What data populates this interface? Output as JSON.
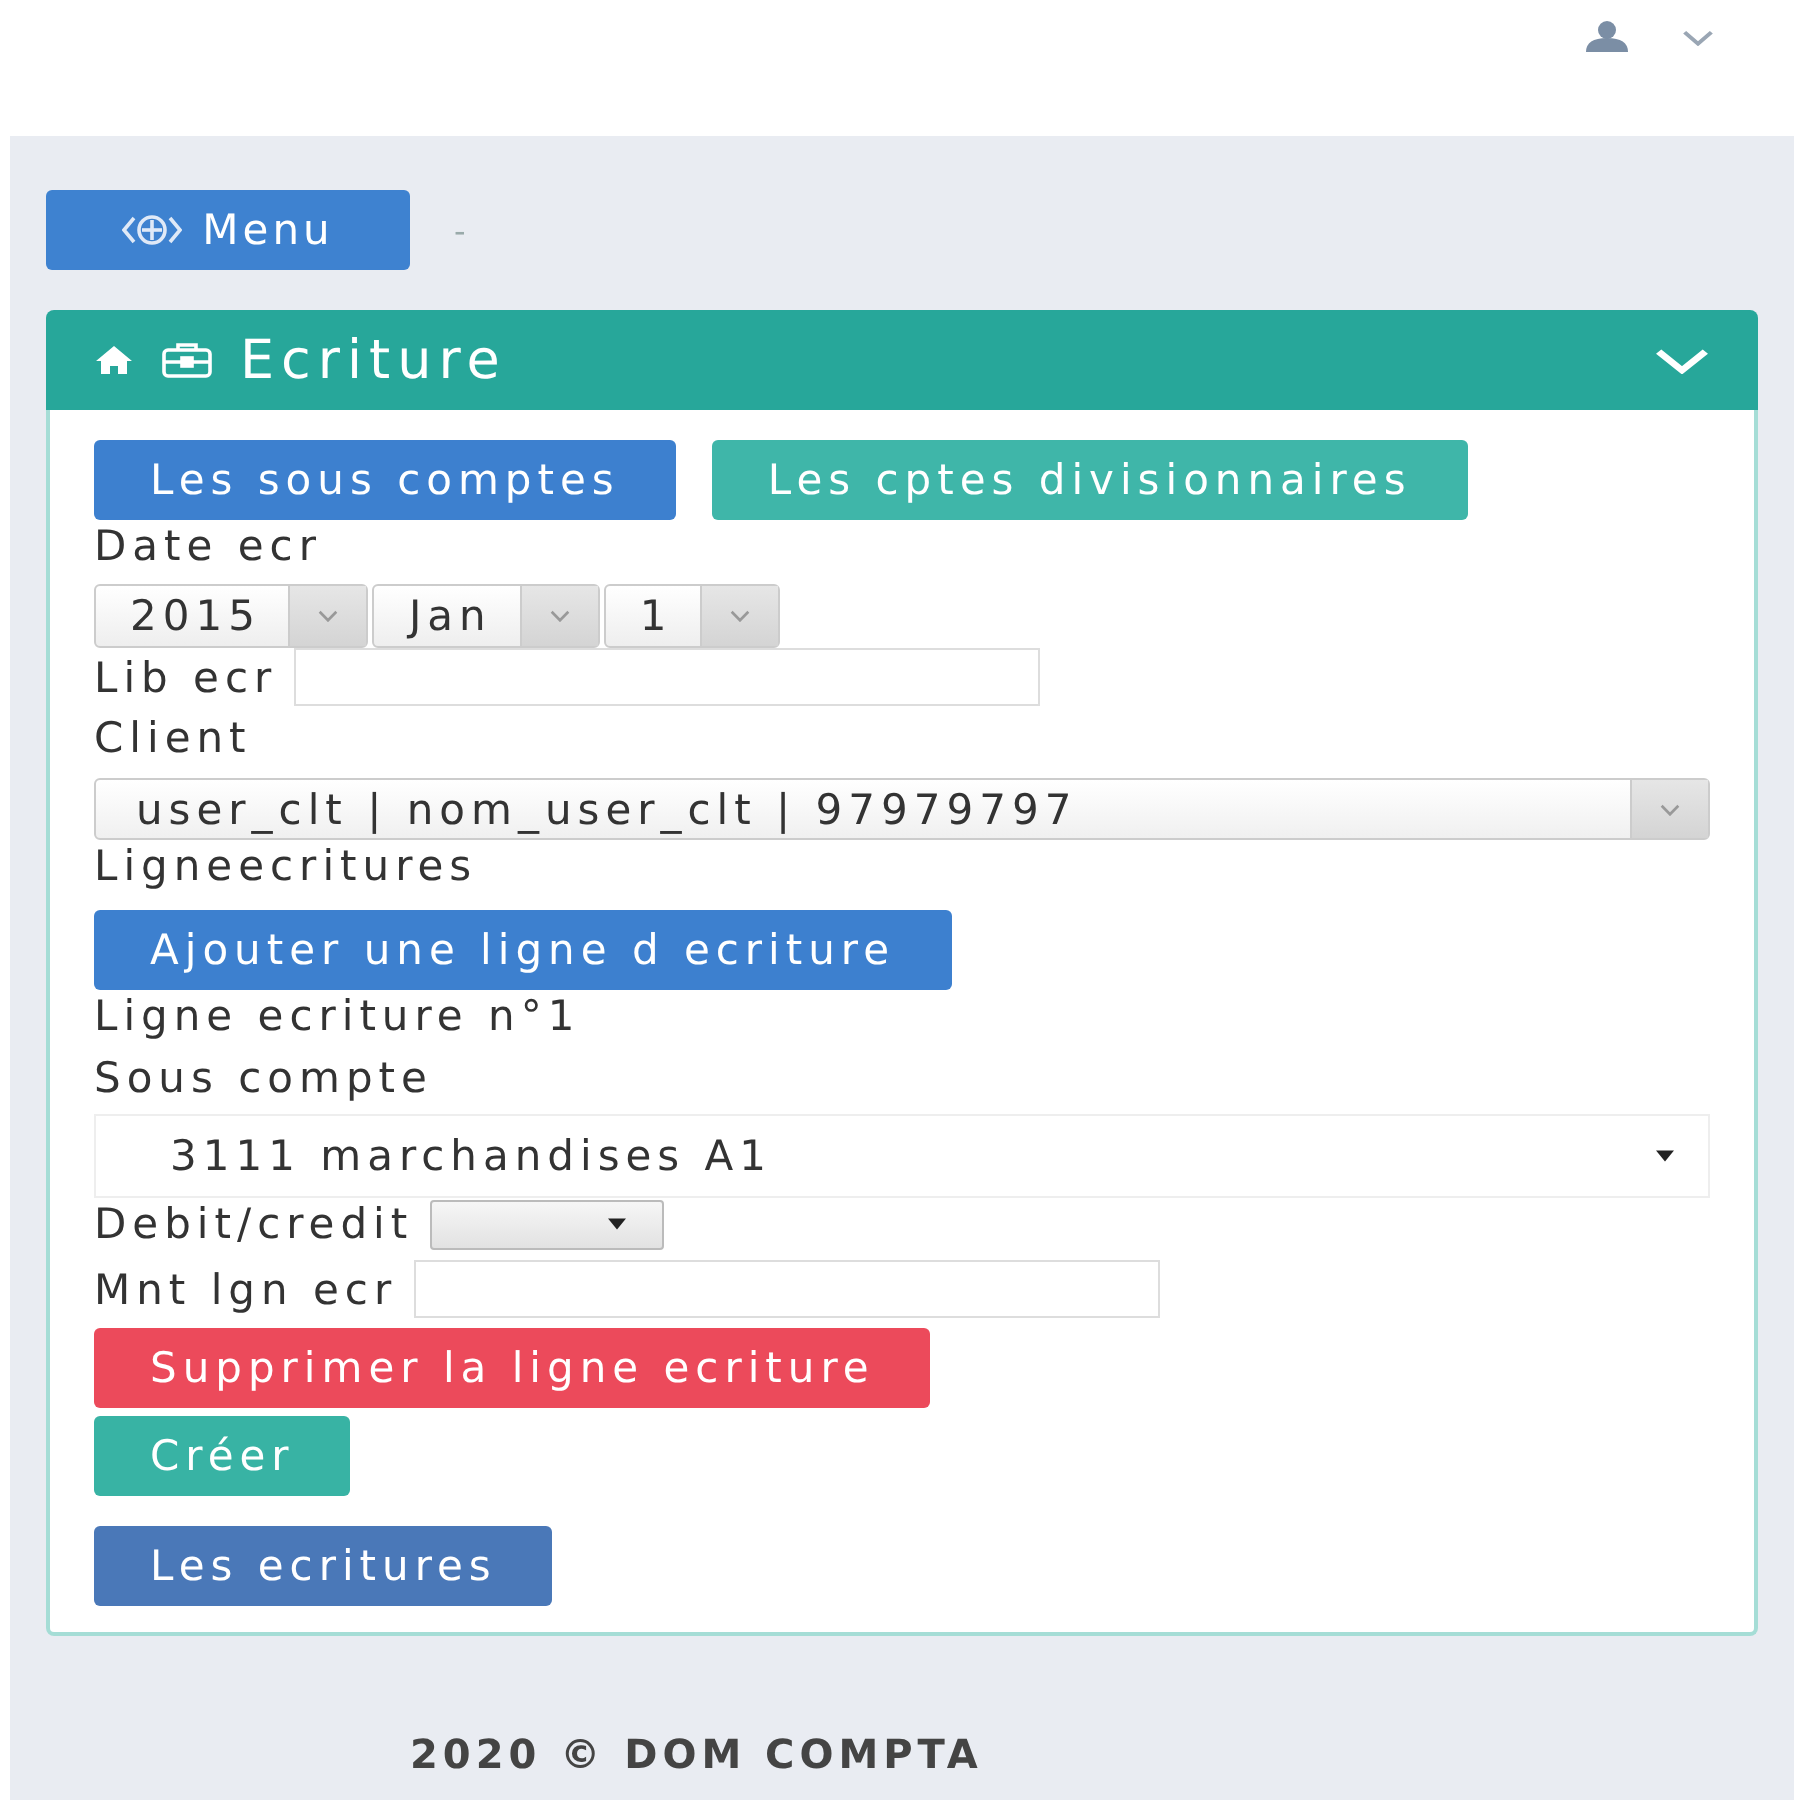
{
  "toolbar": {
    "menu_button": "Menu",
    "separator": "-"
  },
  "panel": {
    "title": "Ecriture",
    "nav_buttons": [
      {
        "label": "Les sous comptes",
        "kind": "primary"
      },
      {
        "label": "Les cptes divisionnaires",
        "kind": "info"
      }
    ],
    "form": [
      {
        "kind": "label",
        "text": "Date ecr"
      },
      {
        "kind": "date",
        "parts": [
          "2015",
          "Jan",
          "1"
        ]
      },
      {
        "kind": "input",
        "label": "Lib ecr"
      },
      {
        "kind": "label",
        "text": "Client"
      },
      {
        "kind": "combo",
        "value": "user_clt | nom_user_clt | 97979797"
      },
      {
        "kind": "label",
        "text": "Ligneecritures"
      },
      {
        "kind": "primary",
        "label": "Ajouter une ligne d ecriture"
      },
      {
        "kind": "label",
        "text": "Ligne ecriture n°1"
      },
      {
        "kind": "label",
        "text": "Sous compte"
      },
      {
        "kind": "select",
        "value": "3111 marchandises A1"
      },
      {
        "kind": "small_select",
        "label": "Debit/credit"
      },
      {
        "kind": "input",
        "label": "Mnt lgn ecr"
      },
      {
        "kind": "danger",
        "label": "Supprimer la ligne ecriture"
      },
      {
        "kind": "success",
        "label": "Créer"
      }
    ],
    "back_button": {
      "label": "Les ecritures",
      "kind": "secondary"
    }
  },
  "footer": {
    "text": "2020 © DOM COMPTA"
  }
}
